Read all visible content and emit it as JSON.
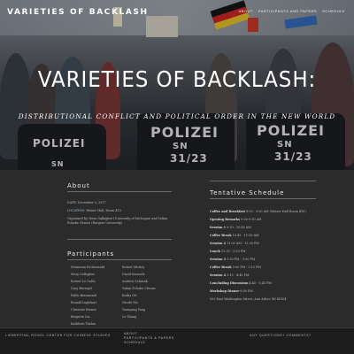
{
  "site": {
    "brand": "VARIETIES OF BACKLASH"
  },
  "nav": [
    "About",
    "Participants and Papers",
    "Schedule"
  ],
  "hero": {
    "title": "VARIETIES OF BACKLASH:",
    "subtitle": "DISTRIBUTIONAL CONFLICT AND POLITICAL ORDER IN THE NEW WORLD",
    "signs": [
      "POLIZEI",
      "SN",
      "31/23",
      "POLIZEI",
      "SN",
      "31/23",
      "POLIZEI",
      "SN"
    ]
  },
  "about": {
    "title": "About",
    "date_label": "DATE:",
    "date": "December 5, 2017",
    "location_label": "LOCATION:",
    "location": "Weiser Hall, Room 415",
    "organizer": "Organized by Mara Gallagher (University of Michigan) and Yolian Echabe Chrorn (Rutgers University)"
  },
  "participants": {
    "title": "Participants",
    "left": [
      "Sebastian Eichenwald",
      "Mary Gallagher",
      "Robert Le Galès",
      "Gary Herrigel",
      "Pablo Beramendi",
      "Ronald Inglehart",
      "Christine Kinnes",
      "Bingwen Liu",
      "Kathleen Thelen"
    ],
    "right": [
      "Robert Mickey",
      "David Samuels",
      "Andrew Schrank",
      "Yolian Echabe Chrorn",
      "Kutha Oti",
      "Nicole Wu",
      "Yuanyang Yang",
      "Le Zhang"
    ]
  },
  "schedule": {
    "title": "Tentative Schedule",
    "items": [
      {
        "label": "Coffee and Breakfast",
        "time": "8:00 - 9:00 AM (Weiser Hall Room 415)"
      },
      {
        "label": "Opening Remarks",
        "time": "9:00-9:10 AM"
      },
      {
        "label": "Session 1",
        "time": "9:10 - 10:45 AM"
      },
      {
        "label": "Coffee Break",
        "time": "10:45 - 11:00 AM"
      },
      {
        "label": "Session 2",
        "time": "11:00 AM - 12:30 PM"
      },
      {
        "label": "Lunch",
        "time": "12:30 - 1:30 PM"
      },
      {
        "label": "Session 3",
        "time": "1:30 PM - 3:00 PM"
      },
      {
        "label": "Coffee Break",
        "time": "3:00 PM - 3:15 PM"
      },
      {
        "label": "Session 4",
        "time": "3:15 - 4:45 PM"
      },
      {
        "label": "Concluding Discussion",
        "time": "4:45 - 5:45 PM"
      },
      {
        "label": "Workshop Dinner",
        "time": "6:00 PM"
      }
    ],
    "address": "500 East Washington Street, Ann Arbor, MI 48104"
  },
  "footer": {
    "left": "Lieberthal Rogel Center for Chinese Studies",
    "middle": [
      "About",
      "Participants & Papers",
      "Schedule"
    ],
    "right": "Any Questions? Comments?"
  },
  "colors": {
    "background": "#2b2b2b",
    "footer": "#1d1d1d",
    "link": "#a7b9c8"
  }
}
